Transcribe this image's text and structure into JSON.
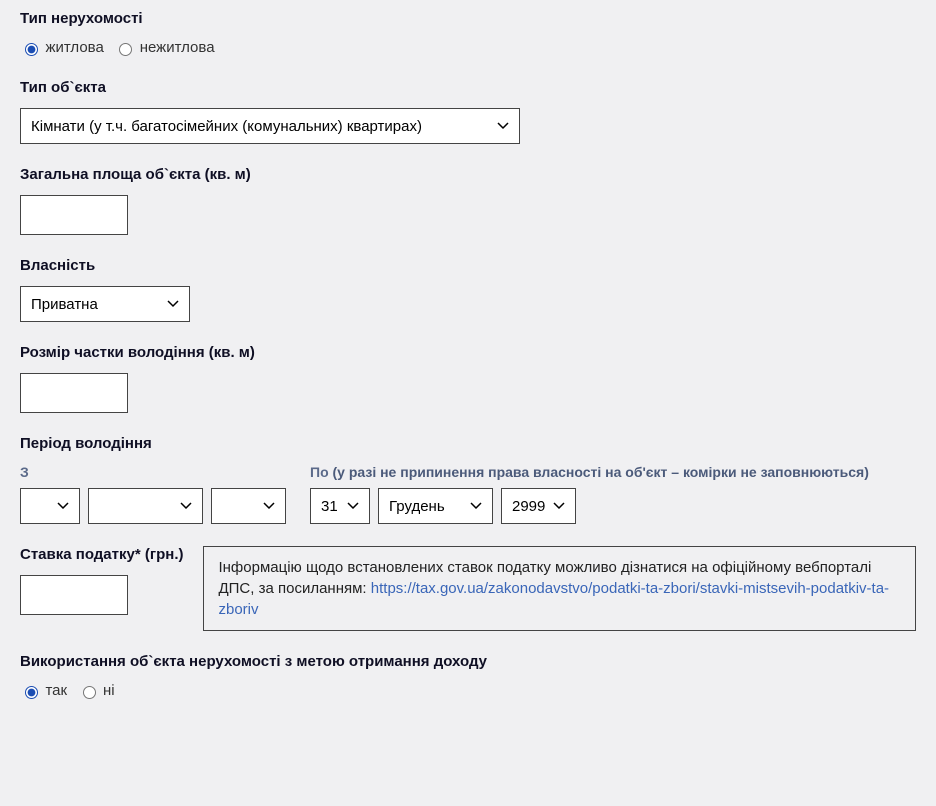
{
  "property_type": {
    "label": "Тип нерухомості",
    "options": {
      "residential": "житлова",
      "nonresidential": "нежитлова"
    },
    "selected": "residential"
  },
  "object_type": {
    "label": "Тип об`єкта",
    "selected": "Кімнати (у т.ч. багатосімейних (комунальних) квартирах)"
  },
  "total_area": {
    "label": "Загальна площа об`єкта (кв. м)",
    "value": ""
  },
  "ownership": {
    "label": "Власність",
    "selected": "Приватна"
  },
  "share_size": {
    "label": "Розмір частки володіння (кв. м)",
    "value": ""
  },
  "period": {
    "label": "Період володіння",
    "from_label": "З",
    "to_label": "По",
    "to_hint": "(у разі не припинення права власності на об'єкт – комірки не заповнюються)",
    "from": {
      "day": "",
      "month": "",
      "year": ""
    },
    "to": {
      "day": "31",
      "month": "Грудень",
      "year": "2999"
    }
  },
  "tax_rate": {
    "label": "Ставка податку* (грн.)",
    "value": "",
    "info_text": "Інформацію щодо встановлених ставок податку можливо дізнатися на офіційному вебпорталі ДПС, за посиланням: ",
    "info_link_text": "https://tax.gov.ua/zakonodavstvo/podatki-ta-zbori/stavki-mistsevih-podatkiv-ta-zboriv"
  },
  "income_use": {
    "label": "Використання об`єкта нерухомості з метою отримання доходу",
    "options": {
      "yes": "так",
      "no": "ні"
    },
    "selected": "yes"
  }
}
